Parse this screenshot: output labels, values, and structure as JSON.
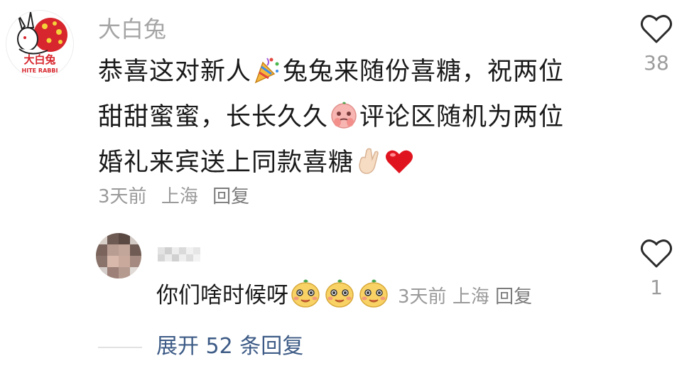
{
  "comment": {
    "author": "大白兔",
    "avatar_logo_text": "大白兔",
    "avatar_logo_subtext": "HITE RABBI",
    "text_lines": [
      [
        "恭喜这对新人",
        "🎉",
        "兔兔来随份喜糖，祝两位"
      ],
      [
        "甜甜蜜蜜，长长久久",
        "🥺",
        "评论区随机为两位"
      ],
      [
        "婚礼来宾送上同款喜糖",
        "🤞",
        "❤️"
      ]
    ],
    "time": "3天前",
    "location": "上海",
    "reply_label": "回复",
    "like_count": "38"
  },
  "reply": {
    "text": "你们啥时候呀",
    "emojis": [
      "😊",
      "😊",
      "😊"
    ],
    "time": "3天前",
    "location": "上海",
    "reply_label": "回复",
    "like_count": "1"
  },
  "expand": {
    "label": "展开 52 条回复"
  },
  "colors": {
    "heart_outline": "#2b2b2b",
    "like_count": "#9c9c9c",
    "link_blue": "#3d5b86",
    "rabbit_red": "#d7262d"
  }
}
